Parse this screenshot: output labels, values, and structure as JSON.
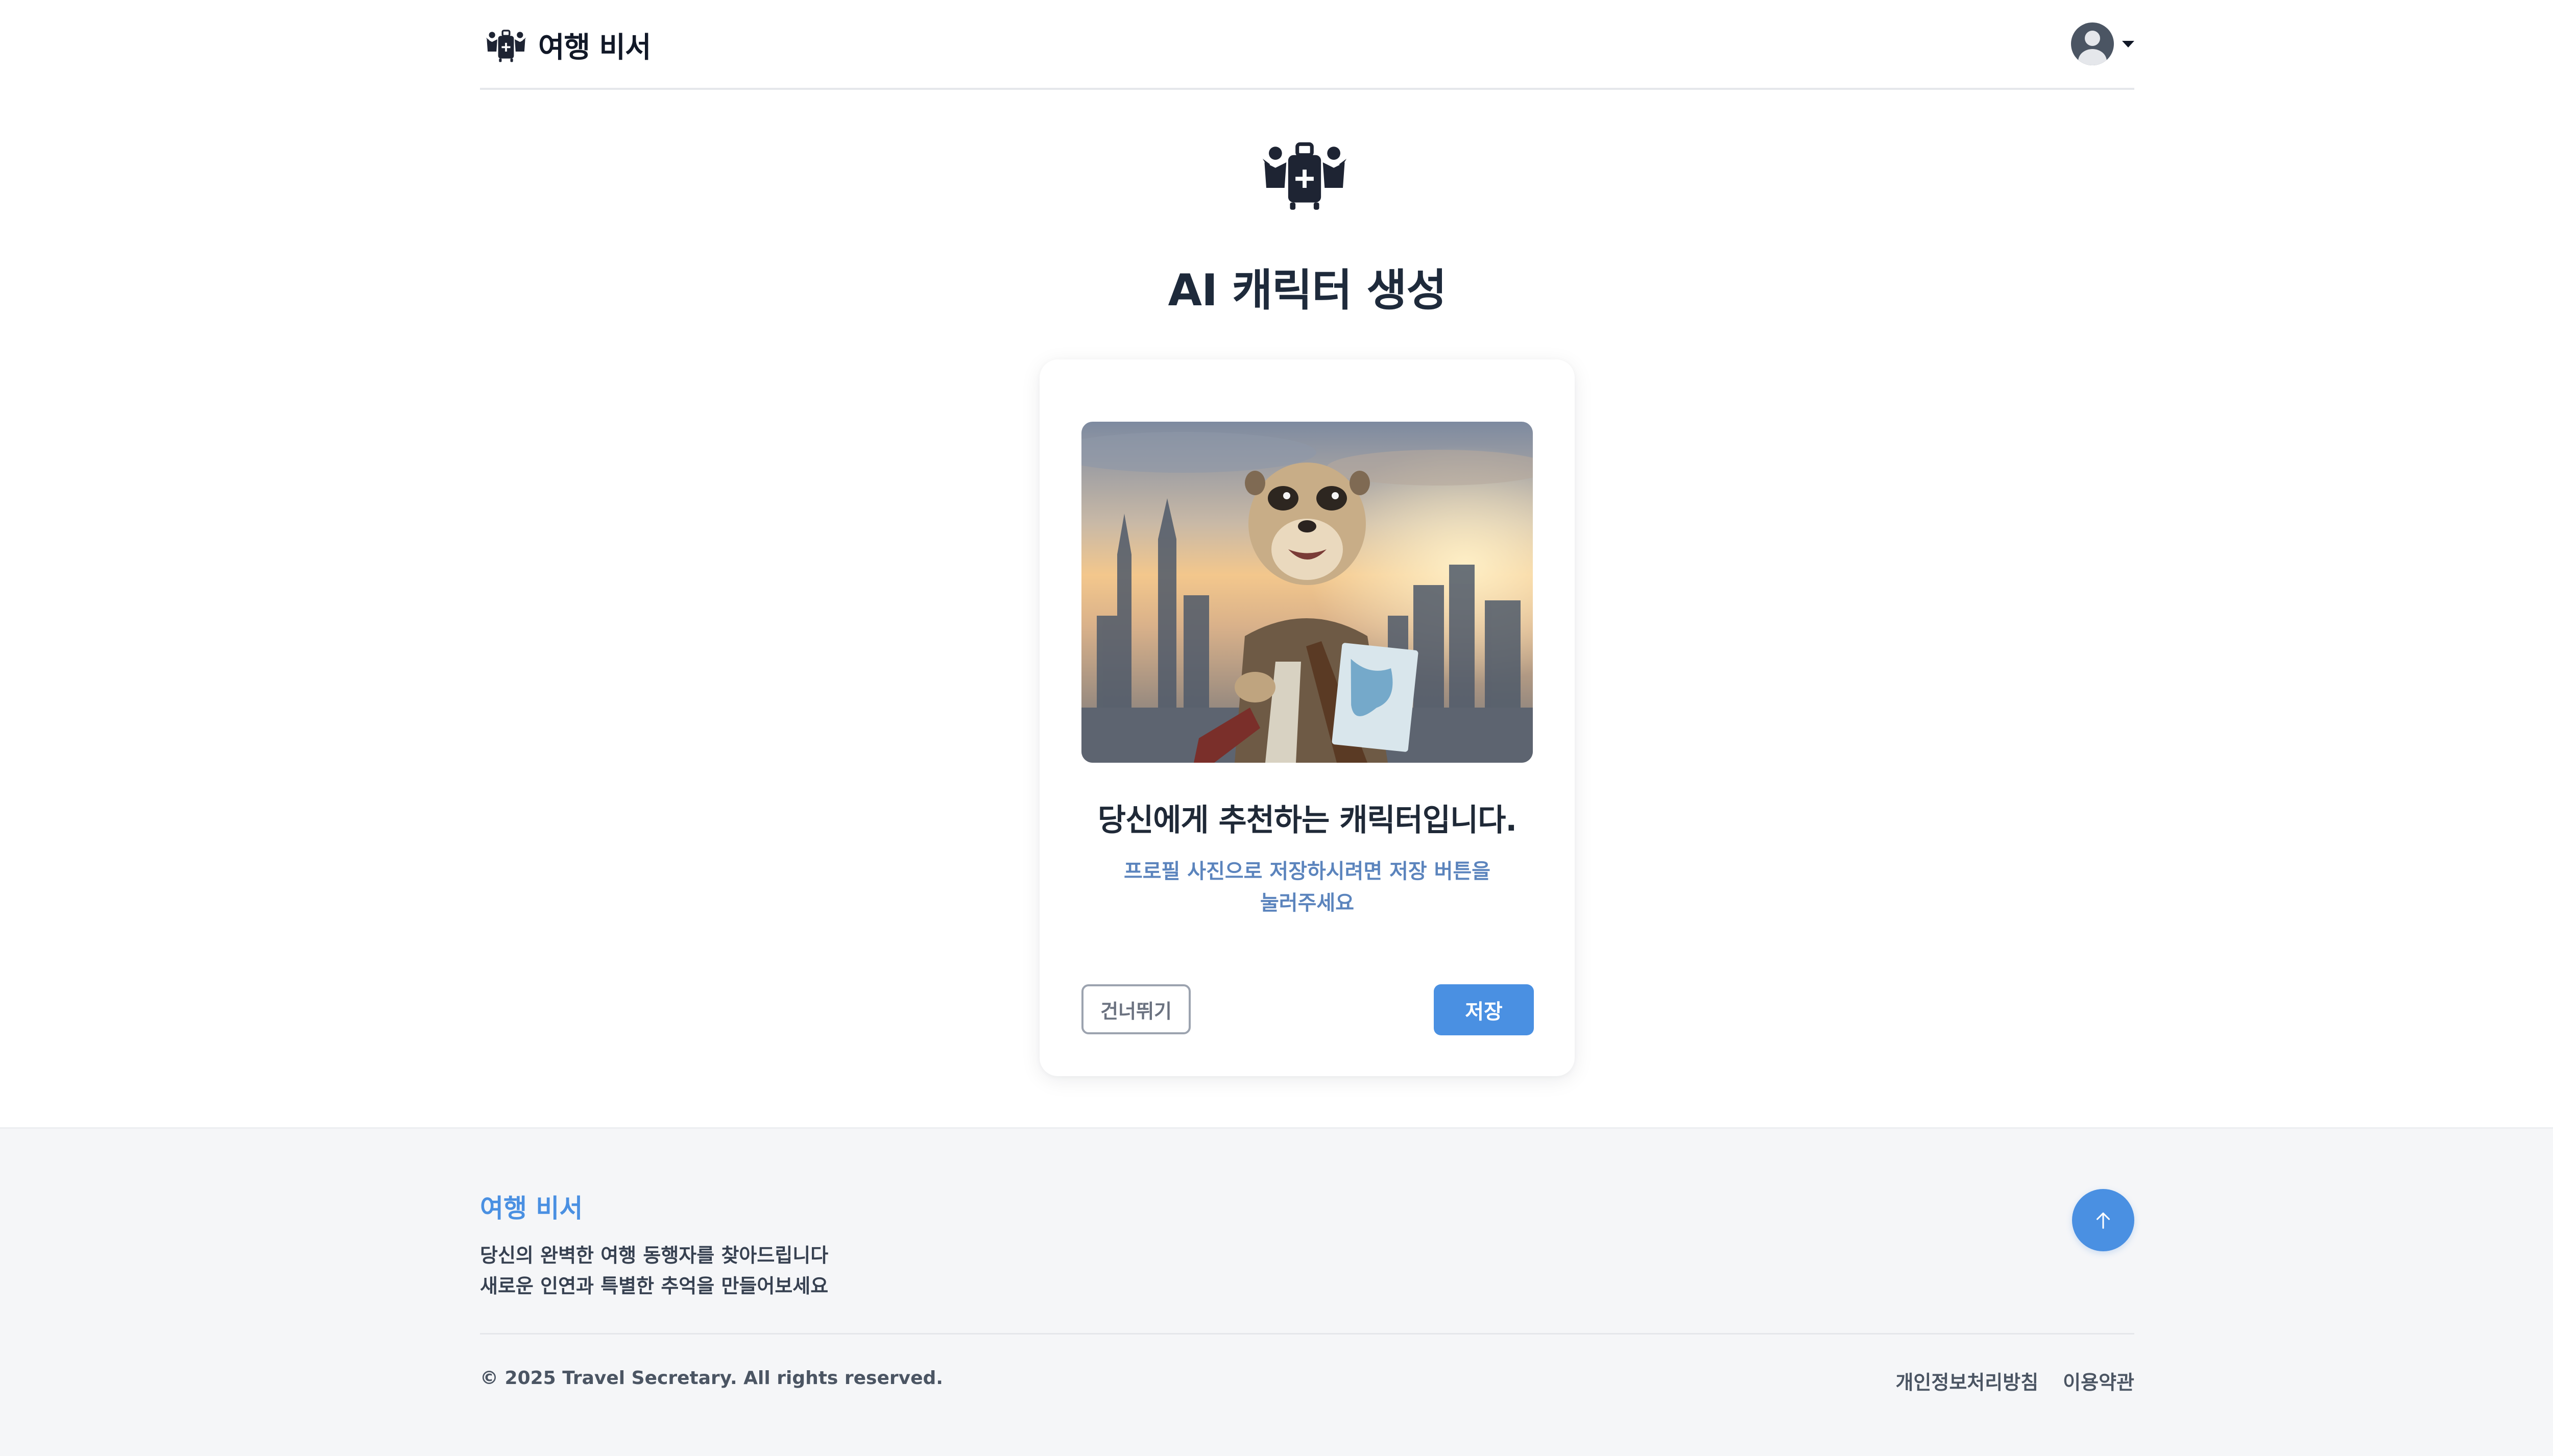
{
  "header": {
    "brand_name": "여행 비서",
    "logo_icon": "travel-companions-logo-icon",
    "user_icon": "user-avatar-icon"
  },
  "main": {
    "title": "AI 캐릭터 생성",
    "hero_icon": "travel-companions-logo-icon"
  },
  "card": {
    "image_alt": "meerkat-traveler-character",
    "heading": "당신에게 추천하는 캐릭터입니다.",
    "subtext_line1": "프로필 사진으로 저장하시려면 저장 버튼을",
    "subtext_line2": "눌러주세요",
    "skip_label": "건너뛰기",
    "save_label": "저장"
  },
  "footer": {
    "brand_name": "여행 비서",
    "tagline_line1": "당신의 완벽한 여행 동행자를 찾아드립니다",
    "tagline_line2": "새로운 인연과 특별한 추억을 만들어보세요",
    "copyright": "© 2025 Travel Secretary. All rights reserved.",
    "links": [
      "개인정보처리방침",
      "이용약관"
    ],
    "scroll_top_icon": "arrow-up-icon"
  },
  "colors": {
    "accent": "#4a90e2",
    "title": "#1e2a3b",
    "subtext": "#5b84bd",
    "footer_bg": "#f5f6f8"
  }
}
